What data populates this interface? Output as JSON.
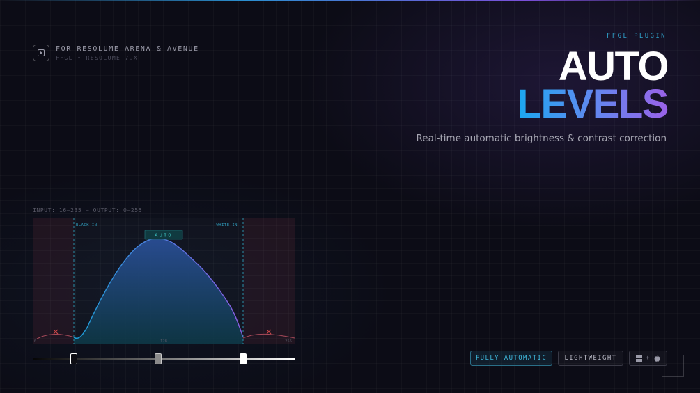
{
  "host": {
    "icon": "play-icon",
    "title": "FOR RESOLUME ARENA & AVENUE",
    "subtitle": "FFGL • RESOLUME 7.X"
  },
  "hero": {
    "kicker": "FFGL PLUGIN",
    "title_line1": "AUTO",
    "title_line2": "LEVELS",
    "tagline": "Real-time automatic brightness & contrast correction"
  },
  "histogram": {
    "io_label": "INPUT: 16–235 → OUTPUT: 0–255",
    "black_in_label": "BLACK IN",
    "white_in_label": "WHITE IN",
    "auto_badge": "AUTO",
    "tick_min": "0",
    "tick_mid": "128",
    "tick_max": "255"
  },
  "levels_slider": {
    "black_point": 16,
    "gamma_midpoint": 128,
    "white_point": 235,
    "range": [
      0,
      255
    ]
  },
  "badges": {
    "auto": "FULLY AUTOMATIC",
    "light": "LIGHTWEIGHT",
    "os_separator": "+",
    "os_icons": [
      "windows-icon",
      "apple-icon"
    ]
  },
  "colors": {
    "accent_cyan": "#2fa0c8",
    "accent_blue": "#1aa8f0",
    "accent_purple": "#9a62e8",
    "clip_red": "#d04848"
  }
}
